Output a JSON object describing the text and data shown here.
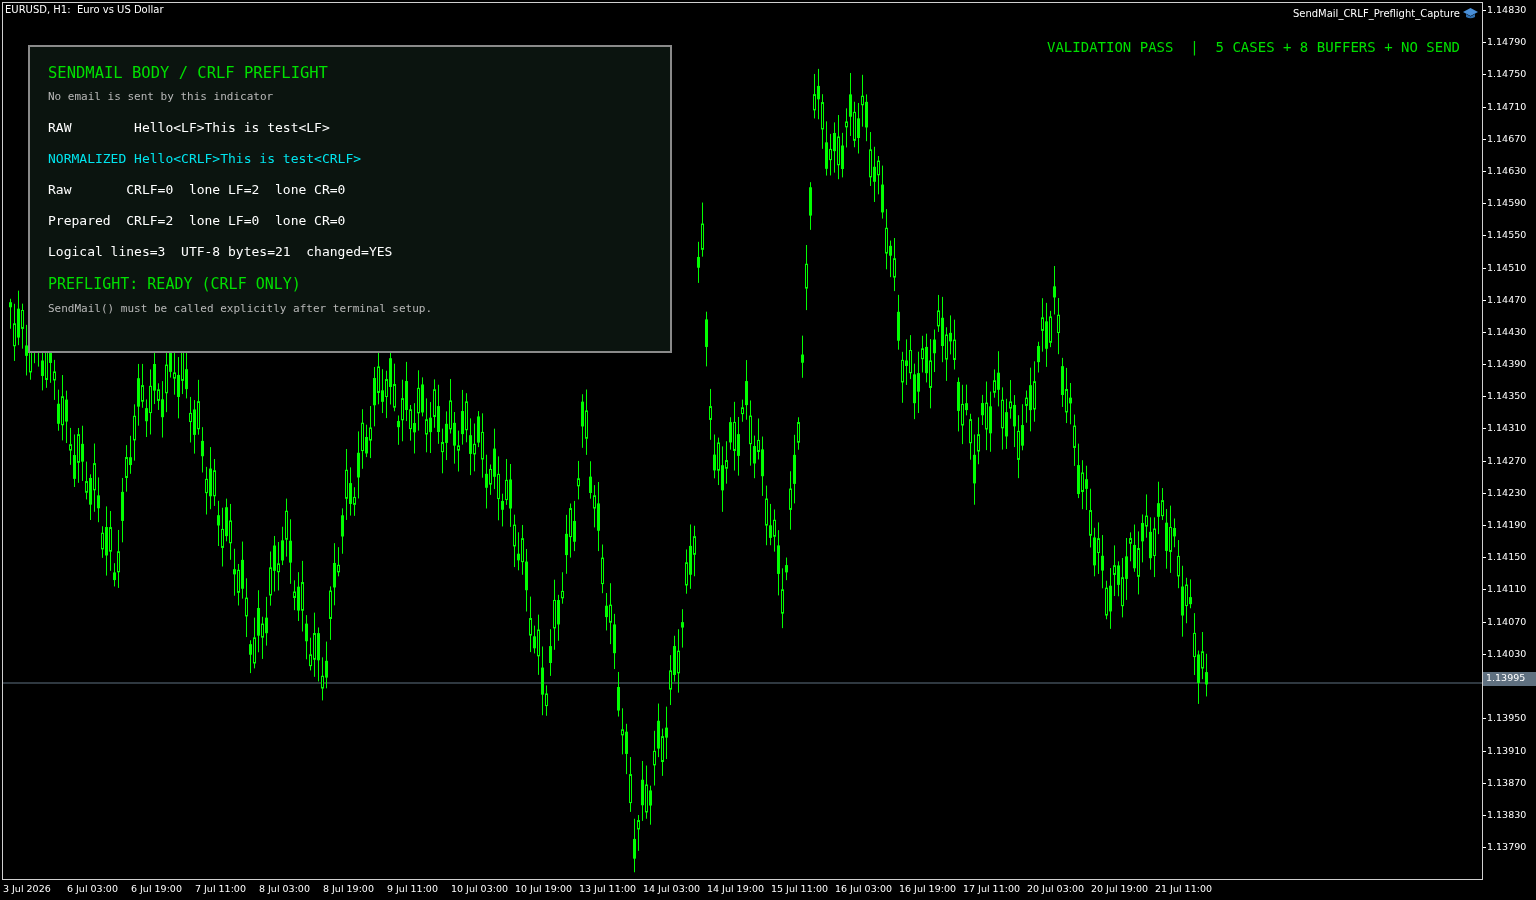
{
  "chart": {
    "title": "EURUSD, H1:  Euro vs US Dollar",
    "indicator": "SendMail_CRLF_Preflight_Capture",
    "banner": "VALIDATION PASS  |  5 CASES + 8 BUFFERS + NO SEND"
  },
  "panel": {
    "title": "SENDMAIL BODY / CRLF PREFLIGHT",
    "subtitle": "No email is sent by this indicator",
    "lines": [
      {
        "text": "RAW        Hello<LF>This is test<LF>",
        "color": "#ffffff"
      },
      {
        "text": "NORMALIZED Hello<CRLF>This is test<CRLF>",
        "color": "#00e5ee"
      },
      {
        "text": "Raw       CRLF=0  lone LF=2  lone CR=0",
        "color": "#ffffff"
      },
      {
        "text": "Prepared  CRLF=2  lone LF=0  lone CR=0",
        "color": "#ffffff"
      },
      {
        "text": "Logical lines=3  UTF-8 bytes=21  changed=YES",
        "color": "#ffffff"
      }
    ],
    "status": "PREFLIGHT: READY (CRLF ONLY)",
    "footer": "SendMail() must be called explicitly after terminal setup."
  },
  "price_axis": {
    "ticks": [
      {
        "kind": "tick",
        "label": "1.14830"
      },
      {
        "kind": "tick",
        "label": "1.14790"
      },
      {
        "kind": "tick",
        "label": "1.14750"
      },
      {
        "kind": "tick",
        "label": "1.14710"
      },
      {
        "kind": "tick",
        "label": "1.14670"
      },
      {
        "kind": "tick",
        "label": "1.14630"
      },
      {
        "kind": "tick",
        "label": "1.14590"
      },
      {
        "kind": "tick",
        "label": "1.14550"
      },
      {
        "kind": "tick",
        "label": "1.14510"
      },
      {
        "kind": "tick",
        "label": "1.14470"
      },
      {
        "kind": "tick",
        "label": "1.14430"
      },
      {
        "kind": "tick",
        "label": "1.14390"
      },
      {
        "kind": "tick",
        "label": "1.14350"
      },
      {
        "kind": "tick",
        "label": "1.14310"
      },
      {
        "kind": "tick",
        "label": "1.14270"
      },
      {
        "kind": "tick",
        "label": "1.14230"
      },
      {
        "kind": "tick",
        "label": "1.14190"
      },
      {
        "kind": "tick",
        "label": "1.14150"
      },
      {
        "kind": "tick",
        "label": "1.14110"
      },
      {
        "kind": "tick",
        "label": "1.14070"
      },
      {
        "kind": "tick",
        "label": "1.14030"
      },
      {
        "kind": "current",
        "label": "1.13995"
      },
      {
        "kind": "tick",
        "label": "1.13950"
      },
      {
        "kind": "tick",
        "label": "1.13910"
      },
      {
        "kind": "tick",
        "label": "1.13870"
      },
      {
        "kind": "tick",
        "label": "1.13830"
      },
      {
        "kind": "tick",
        "label": "1.13790"
      }
    ]
  },
  "time_axis": {
    "labels": [
      "3 Jul 2026",
      "6 Jul 03:00",
      "6 Jul 19:00",
      "7 Jul 11:00",
      "8 Jul 03:00",
      "8 Jul 19:00",
      "9 Jul 11:00",
      "10 Jul 03:00",
      "10 Jul 19:00",
      "13 Jul 11:00",
      "14 Jul 03:00",
      "14 Jul 19:00",
      "15 Jul 11:00",
      "16 Jul 03:00",
      "16 Jul 19:00",
      "17 Jul 11:00",
      "20 Jul 03:00",
      "20 Jul 19:00",
      "21 Jul 11:00"
    ]
  }
}
